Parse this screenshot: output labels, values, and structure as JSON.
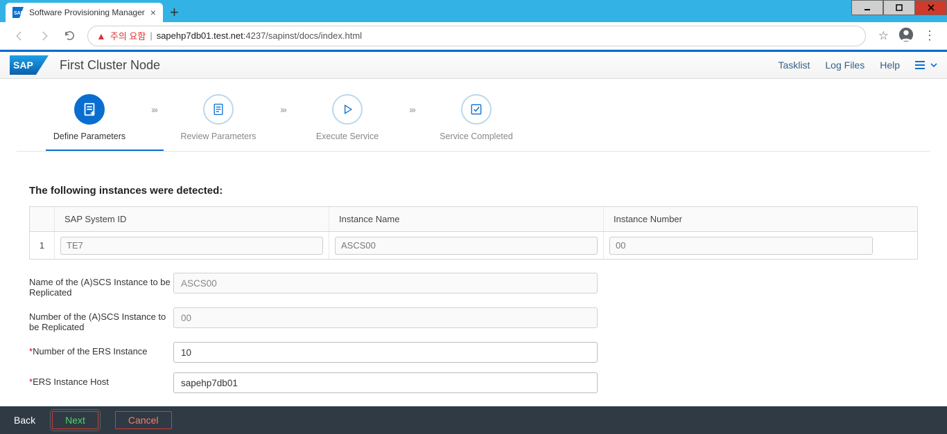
{
  "browser": {
    "tab_title": "Software Provisioning Manager",
    "warning_label": "주의 요함",
    "url_host": "sapehp7db01.test.net",
    "url_port_path": ":4237/sapinst/docs/index.html"
  },
  "header": {
    "title": "First Cluster Node",
    "links": {
      "tasklist": "Tasklist",
      "logfiles": "Log Files",
      "help": "Help"
    }
  },
  "steps": {
    "s1": "Define Parameters",
    "s2": "Review Parameters",
    "s3": "Execute Service",
    "s4": "Service Completed"
  },
  "main": {
    "section_title": "The following instances were detected:",
    "table": {
      "headers": {
        "sys_id": "SAP System ID",
        "inst_name": "Instance Name",
        "inst_num": "Instance Number"
      },
      "row1": {
        "idx": "1",
        "sys_id": "TE7",
        "inst_name": "ASCS00",
        "inst_num": "00"
      }
    },
    "form": {
      "label_ascs_name": "Name of the (A)SCS Instance to be Replicated",
      "val_ascs_name": "ASCS00",
      "label_ascs_num": "Number of the (A)SCS Instance to be Replicated",
      "val_ascs_num": "00",
      "label_ers_num": "Number of the ERS Instance",
      "val_ers_num": "10",
      "label_ers_host": "ERS Instance Host",
      "val_ers_host": "sapehp7db01",
      "required": "*"
    }
  },
  "footer": {
    "back": "Back",
    "next": "Next",
    "cancel": "Cancel"
  }
}
